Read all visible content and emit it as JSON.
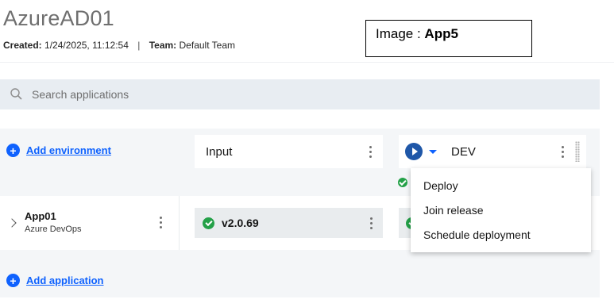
{
  "header": {
    "title": "AzureAD01",
    "created_label": "Created:",
    "created_value": "1/24/2025, 11:12:54",
    "separator": "|",
    "team_label": "Team:",
    "team_value": "Default Team"
  },
  "image_box": {
    "prefix": "Image : ",
    "name": "App5"
  },
  "search": {
    "placeholder": "Search applications",
    "value": ""
  },
  "actions": {
    "add_environment": "Add environment",
    "add_application": "Add application"
  },
  "environments": [
    {
      "label": "Input"
    },
    {
      "label": "DEV"
    }
  ],
  "applications": [
    {
      "name": "App01",
      "source": "Azure DevOps",
      "version": "v2.0.69",
      "status": "success"
    }
  ],
  "menu": {
    "items": [
      "Deploy",
      "Join release",
      "Schedule deployment"
    ]
  },
  "colors": {
    "link": "#0f62fe",
    "play": "#1f57a8",
    "success": "#24a148",
    "search_bg": "#e8edf2"
  }
}
